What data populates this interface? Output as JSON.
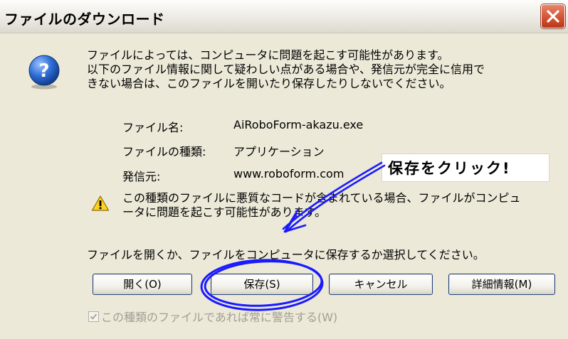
{
  "window": {
    "title": "ファイルのダウンロード",
    "close_icon": "close-icon"
  },
  "message": {
    "icon": "question-icon",
    "lines": [
      "ファイルによっては、コンピュータに問題を起こす可能性があります。",
      "以下のファイル情報に関して疑わしい点がある場合や、発信元が完全に信用で",
      "きない場合は、このファイルを開いたり保存したりしないでください。"
    ]
  },
  "file_info": {
    "name_label": "ファイル名:",
    "name_value": "AiRoboForm-akazu.exe",
    "type_label": "ファイルの種類:",
    "type_value": "アプリケーション",
    "source_label": "発信元:",
    "source_value": "www.roboform.com"
  },
  "warning": {
    "icon": "warning-icon",
    "lines": [
      "この種類のファイルに悪質なコードが含まれている場合、ファイルがコンピュ",
      "ータに問題を起こす可能性があります。"
    ]
  },
  "prompt": "ファイルを開くか、ファイルをコンピュータに保存するか選択してください。",
  "buttons": {
    "open": "開く(O)",
    "save": "保存(S)",
    "cancel": "キャンセル",
    "details": "詳細情報(M)"
  },
  "checkbox": {
    "label": "この種類のファイルであれば常に警告する(W)",
    "checked": true
  },
  "annotation": {
    "text": "保存をクリック!",
    "color": "#1a1aff"
  }
}
